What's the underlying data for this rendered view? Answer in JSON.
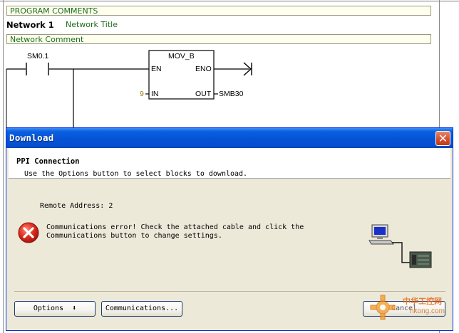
{
  "editor": {
    "program_comments": "PROGRAM COMMENTS",
    "network_label": "Network 1",
    "network_title": "Network Title",
    "network_comment": "Network Comment",
    "contact_label": "SM0.1",
    "block_name": "MOV_B",
    "pin_en": "EN",
    "pin_eno": "ENO",
    "pin_in": "IN",
    "pin_out": "OUT",
    "in_value": "9",
    "out_value": "SMB30"
  },
  "dialog": {
    "title": "Download",
    "header_title": "PPI Connection",
    "header_subtitle": "Use the Options button to select blocks to download.",
    "remote_address": "Remote Address: 2",
    "error_line1": "Communications error! Check the attached cable and click the",
    "error_line2": "Communications button to change settings.",
    "options_label": "Options  ⬇",
    "communications_label": "Communications...",
    "cancel_label": "Cancel",
    "close_glyph": "✕"
  },
  "watermark": {
    "text": "中华工控网",
    "url": "hkong.com"
  },
  "icons": {
    "error": "error-icon",
    "computer": "computer-plc-icon",
    "close": "close-icon"
  },
  "colors": {
    "titlebar": "#0554d6",
    "comment_text": "#1a6e1a",
    "dialog_bg": "#ece9d8",
    "error_red": "#d8281c"
  }
}
